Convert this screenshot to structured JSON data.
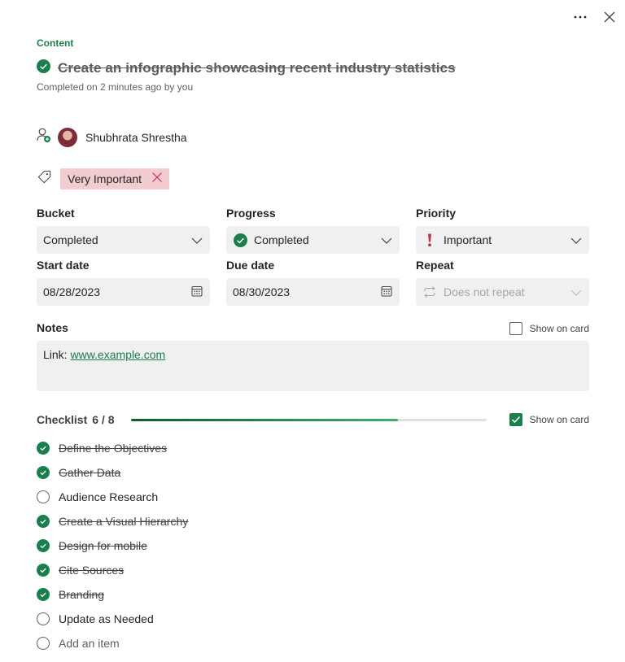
{
  "header": {
    "more_icon": "more-horizontal-icon",
    "close_icon": "close-icon"
  },
  "task": {
    "section": "Content",
    "title": "Create an infographic showcasing recent industry statistics",
    "completed_info": "Completed on 2 minutes ago by you",
    "status_color": "#1a7f4b"
  },
  "assignee": {
    "icon": "assign-person-icon",
    "name": "Shubhrata Shrestha"
  },
  "label": {
    "icon": "tag-icon",
    "text": "Very Important",
    "color": "#f3ccd2"
  },
  "fields": {
    "bucket": {
      "label": "Bucket",
      "value": "Completed"
    },
    "progress": {
      "label": "Progress",
      "value": "Completed",
      "icon": "completed-check-icon"
    },
    "priority": {
      "label": "Priority",
      "value": "Important",
      "icon": "exclamation-icon",
      "color": "#c4314b"
    },
    "start_date": {
      "label": "Start date",
      "value": "08/28/2023"
    },
    "due_date": {
      "label": "Due date",
      "value": "08/30/2023"
    },
    "repeat": {
      "label": "Repeat",
      "value": "Does not repeat",
      "icon": "repeat-icon"
    }
  },
  "notes": {
    "label": "Notes",
    "show_on_card": "Show on card",
    "show_on_card_checked": false,
    "prefix": "Link: ",
    "link": "www.example.com"
  },
  "checklist": {
    "label": "Checklist",
    "count": "6 / 8",
    "progress": 0.75,
    "show_on_card": "Show on card",
    "show_on_card_checked": true,
    "items": [
      {
        "text": "Define the Objectives",
        "done": true
      },
      {
        "text": "Gather Data",
        "done": true
      },
      {
        "text": "Audience Research",
        "done": false
      },
      {
        "text": "Create a Visual Hierarchy",
        "done": true
      },
      {
        "text": "Design for mobile",
        "done": true
      },
      {
        "text": "Cite Sources",
        "done": true
      },
      {
        "text": "Branding",
        "done": true
      },
      {
        "text": "Update as Needed",
        "done": false
      }
    ],
    "add_item": "Add an item"
  }
}
